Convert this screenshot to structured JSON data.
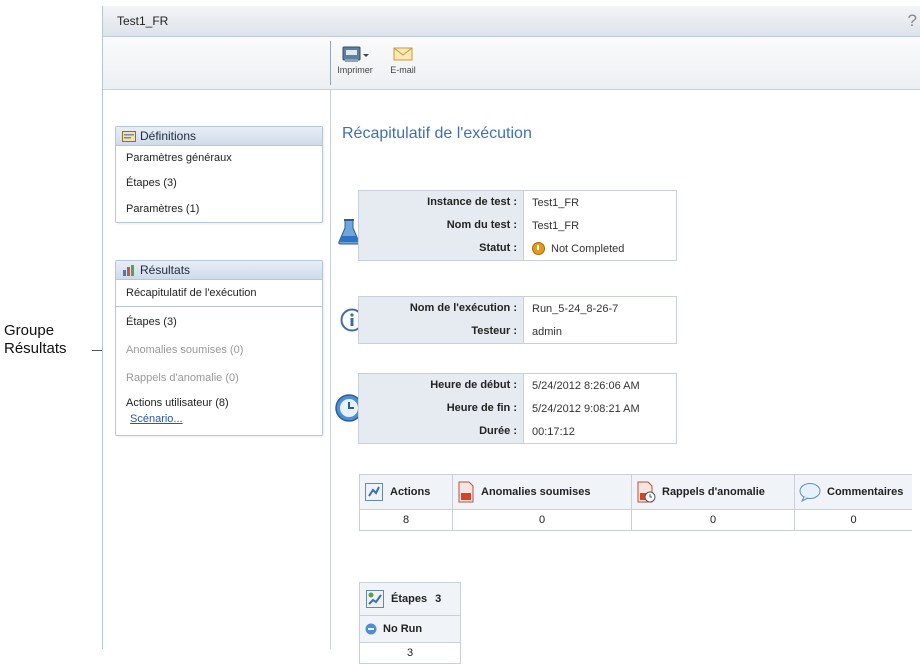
{
  "callout": {
    "line1": "Groupe",
    "line2": "Résultats"
  },
  "window": {
    "title": "Test1_FR",
    "help_glyph": "?"
  },
  "toolbar": {
    "print_label": "Imprimer",
    "email_label": "E-mail"
  },
  "definitions": {
    "header": "Définitions",
    "items": [
      "Paramètres généraux",
      "Étapes (3)",
      "Paramètres (1)"
    ]
  },
  "results": {
    "header": "Résultats",
    "items": [
      {
        "label": "Récapitulatif de l'exécution",
        "enabled": true,
        "active": true
      },
      {
        "label": "Étapes (3)",
        "enabled": true
      },
      {
        "label": "Anomalies soumises (0)",
        "enabled": false
      },
      {
        "label": "Rappels d'anomalie (0)",
        "enabled": false
      },
      {
        "label": "Actions utilisateur (8)",
        "enabled": true
      }
    ],
    "link": "Scénario..."
  },
  "summary": {
    "title": "Récapitulatif de l'exécution",
    "test": {
      "instance_label": "Instance de test :",
      "instance_value": "Test1_FR",
      "name_label": "Nom du test :",
      "name_value": "Test1_FR",
      "status_label": "Statut :",
      "status_value": "Not Completed"
    },
    "run": {
      "run_name_label": "Nom de l'exécution :",
      "run_name_value": "Run_5-24_8-26-7",
      "tester_label": "Testeur :",
      "tester_value": "admin"
    },
    "time": {
      "start_label": "Heure de début :",
      "start_value": "5/24/2012 8:26:06 AM",
      "end_label": "Heure de fin :",
      "end_value": "5/24/2012 9:08:21 AM",
      "duration_label": "Durée :",
      "duration_value": "00:17:12"
    },
    "stats": {
      "actions_label": "Actions",
      "actions_value": "8",
      "defects_label": "Anomalies soumises",
      "defects_value": "0",
      "reminders_label": "Rappels d'anomalie",
      "reminders_value": "0",
      "comments_label": "Commentaires",
      "comments_value": "0"
    },
    "steps": {
      "label": "Étapes",
      "count": "3",
      "norun_label": "No Run",
      "norun_value": "3"
    }
  },
  "colors": {
    "title_blue": "#3f6fb8",
    "status_orange": "#e49a1c",
    "link_blue": "#2a55b5"
  }
}
